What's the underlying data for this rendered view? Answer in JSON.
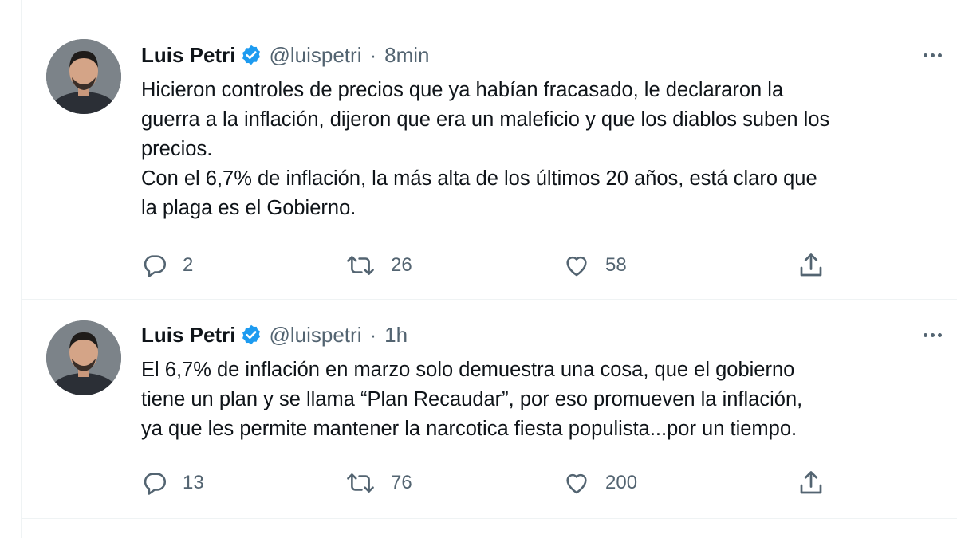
{
  "tweets": [
    {
      "name": "Luis Petri",
      "handle": "@luispetri",
      "separator": "·",
      "time": "8min",
      "text": [
        "Hicieron controles de precios que ya habían fracasado, le declararon la",
        "guerra a la inflación, dijeron que era un maleficio y que los diablos suben los",
        "precios.",
        "Con el 6,7% de inflación, la más alta de los últimos 20 años, está claro que",
        "la plaga es el Gobierno."
      ],
      "replies": "2",
      "retweets": "26",
      "likes": "58"
    },
    {
      "name": "Luis Petri",
      "handle": "@luispetri",
      "separator": "·",
      "time": "1h",
      "text": [
        "El 6,7% de inflación en marzo solo demuestra una cosa, que el gobierno",
        "tiene un plan y se llama “Plan Recaudar”, por eso promueven la inflación,",
        "ya que les permite mantener la narcotica fiesta populista...por un tiempo."
      ],
      "replies": "13",
      "retweets": "76",
      "likes": "200"
    }
  ],
  "icons": {
    "verified": "verified-badge-icon",
    "more": "more-options-icon",
    "reply": "reply-icon",
    "retweet": "retweet-icon",
    "like": "like-icon",
    "share": "share-icon"
  },
  "colors": {
    "verified_blue": "#1d9bf0",
    "secondary_text": "#536471",
    "primary_text": "#0f1419",
    "divider": "#eff3f4"
  }
}
